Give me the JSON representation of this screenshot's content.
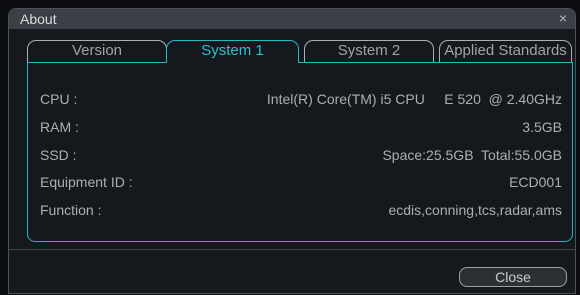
{
  "window": {
    "title": "About",
    "close_glyph": "×"
  },
  "tabs": [
    {
      "label": "Version",
      "active": false
    },
    {
      "label": "System 1",
      "active": true
    },
    {
      "label": "System 2",
      "active": false
    },
    {
      "label": "Applied Standards",
      "active": false
    }
  ],
  "system1": {
    "cpu": {
      "label": "CPU :",
      "value": "Intel(R) Core(TM) i5 CPU     E 520  @ 2.40GHz"
    },
    "ram": {
      "label": "RAM :",
      "value": "3.5GB"
    },
    "ssd": {
      "label": "SSD :",
      "value": "Space:25.5GB  Total:55.0GB"
    },
    "equipment_id": {
      "label": "Equipment ID :",
      "value": "ECD001"
    },
    "function": {
      "label": "Function :",
      "value": "ecdis,conning,tcs,radar,ams"
    }
  },
  "footer": {
    "close_label": "Close"
  },
  "colors": {
    "accent": "#27b6c4",
    "background": "#15191e",
    "titlebar": "#3a4046",
    "text": "#a9b0b5"
  }
}
